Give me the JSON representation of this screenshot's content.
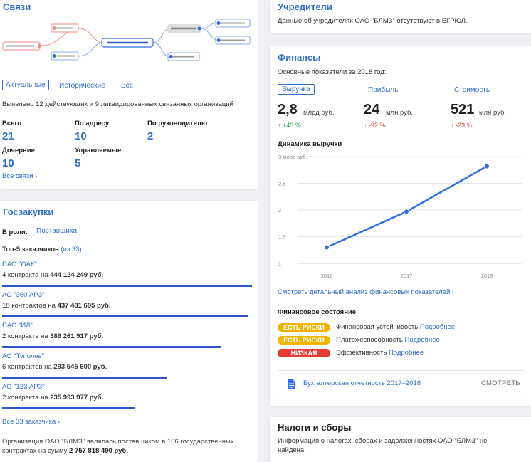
{
  "links": {
    "title": "Связи",
    "tabs": [
      "Актуальные",
      "Исторические",
      "Все"
    ],
    "summary": "Выявлено 12 действующих и 9 ликвидированных связанных организаций",
    "stats": [
      {
        "label": "Всего",
        "value": "21"
      },
      {
        "label": "По адресу",
        "value": "10"
      },
      {
        "label": "По руководителю",
        "value": "2"
      },
      {
        "label": "Дочерние",
        "value": "10"
      },
      {
        "label": "Управляемые",
        "value": "5"
      }
    ],
    "all_link": "Все связи"
  },
  "procurement": {
    "title": "Госзакупки",
    "role_label": "В роли:",
    "role_value": "Поставщика",
    "top_label": "Топ-5 заказчиков",
    "top_count": "(из 33)",
    "customers": [
      {
        "name": "ПАО \"ОАК\"",
        "prefix": "4 контракта на",
        "amount": "444 124 249 руб.",
        "share": 1.0
      },
      {
        "name": "АО \"360 АРЗ\"",
        "prefix": "18 контрактов на",
        "amount": "437 481 695 руб.",
        "share": 0.985
      },
      {
        "name": "ПАО \"ИЛ\"",
        "prefix": "2 контракта на",
        "amount": "389 261 917 руб.",
        "share": 0.876
      },
      {
        "name": "АО \"Туполев\"",
        "prefix": "6 контрактов на",
        "amount": "293 545 600 руб.",
        "share": 0.661
      },
      {
        "name": "АО \"123 АРЗ\"",
        "prefix": "2 контракта на",
        "amount": "235 993 977 руб.",
        "share": 0.531
      }
    ],
    "all_link": "Все 33 заказчика",
    "footer_line1": "Организация ОАО \"БЛМЗ\" являлась поставщиком в 166 государственных",
    "footer_line2_prefix": "контрактах на сумму",
    "footer_line2_amount": "2 757 818 490 руб."
  },
  "founders": {
    "title": "Учредители",
    "text": "Данные об учредителях ОАО \"БЛМЗ\" отсутствуют в ЕГРЮЛ."
  },
  "finance": {
    "title": "Финансы",
    "subtitle": "Основные показатели за 2018 год:",
    "metrics": [
      {
        "label": "Выручка",
        "value": "2,8",
        "unit": "млрд руб.",
        "change": "↑ +43 %",
        "dir": "up"
      },
      {
        "label": "Прибыль",
        "value": "24",
        "unit": "млн руб.",
        "change": "↓ -92 %",
        "dir": "down"
      },
      {
        "label": "Стоимость",
        "value": "521",
        "unit": "млн руб.",
        "change": "↓ -23 %",
        "dir": "down"
      }
    ],
    "chart_title": "Динамика выручки",
    "detail_link": "Смотреть детальный анализ финансовых показателей",
    "state_title": "Финансовое состояние",
    "states": [
      {
        "badge": "ЕСТЬ РИСКИ",
        "color": "#f0b400",
        "text": "Финансовая устойчивость",
        "more": "Подробнее"
      },
      {
        "badge": "ЕСТЬ РИСКИ",
        "color": "#f0b400",
        "text": "Платежеспособность",
        "more": "Подробнее"
      },
      {
        "badge": "НИЗКАЯ",
        "color": "#e53935",
        "text": "Эффективность",
        "more": "Подробнее"
      }
    ],
    "report_text": "Бухгалтерская отчетность 2017–2018",
    "report_button": "СМОТРЕТЬ"
  },
  "taxes": {
    "title": "Налоги и сборы",
    "text1": "Информация о налогах, сборах и задолженностях ОАО \"БЛМЗ\" не",
    "text2": "найдена."
  },
  "chart_data": {
    "type": "line",
    "title": "Динамика выручки",
    "x": [
      "2016",
      "2017",
      "2018"
    ],
    "series": [
      {
        "values": [
          1.3,
          1.97,
          2.82
        ]
      }
    ],
    "y_ticks": [
      "1",
      "1.5",
      "2",
      "2.5",
      "3 млрд руб."
    ],
    "ylim": [
      1,
      3
    ],
    "grid": true,
    "color": "#2f6fe8"
  }
}
